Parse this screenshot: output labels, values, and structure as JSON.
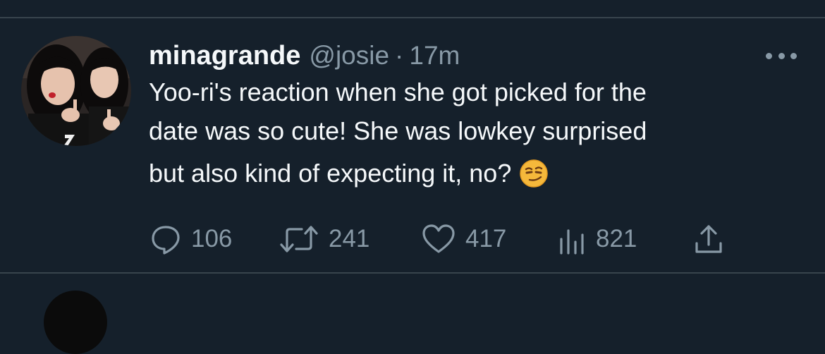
{
  "tweet": {
    "display_name": "minagrande",
    "handle": "@josie",
    "separator": "·",
    "time": "17m",
    "text_lines": [
      "Yoo-ri's reaction when she got picked for the",
      "date was so cute! She was lowkey surprised",
      "but also kind of expecting it, no?"
    ],
    "emoji": "smirking-face"
  },
  "actions": {
    "replies": "106",
    "retweets": "241",
    "likes": "417",
    "views": "821"
  },
  "colors": {
    "background": "#15202b",
    "primary_text": "#f5f8fa",
    "secondary_text": "#8899a6",
    "divider": "#38444d"
  }
}
